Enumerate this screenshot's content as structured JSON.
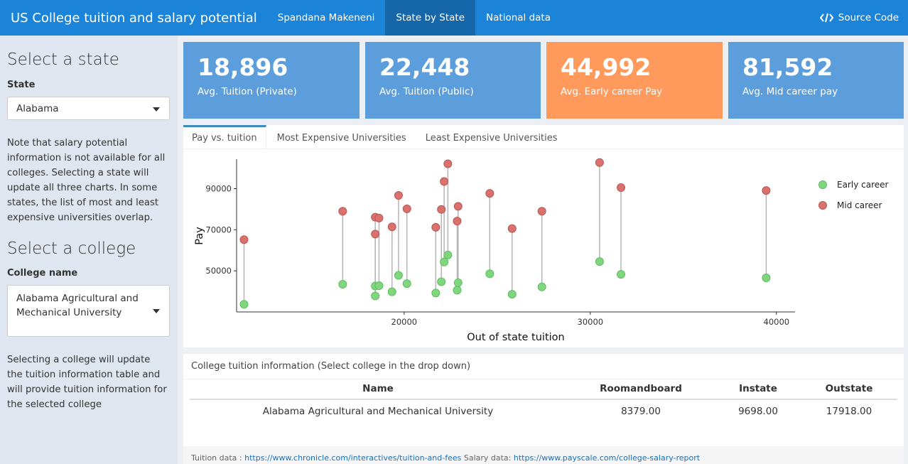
{
  "header": {
    "title": "US College tuition and salary potential",
    "author": "Spandana Makeneni",
    "tabs": [
      "State by State",
      "National data"
    ],
    "source_code": "Source Code"
  },
  "sidebar": {
    "state_heading": "Select a state",
    "state_label": "State",
    "state_value": "Alabama",
    "state_note": "Note that salary potential information is not available for all colleges. Selecting a state will update all three charts. In some states, the list of most and least expensive universities overlap.",
    "college_heading": "Select a college",
    "college_label": "College name",
    "college_value": "Alabama Agricultural and Mechanical University",
    "college_note": "Selecting a college will update the tuition information table and will provide tuition information for the selected college"
  },
  "value_boxes": [
    {
      "value": "18,896",
      "label": "Avg. Tuition (Private)",
      "color": "#5c9ddc"
    },
    {
      "value": "22,448",
      "label": "Avg. Tuition (Public)",
      "color": "#5c9ddc"
    },
    {
      "value": "44,992",
      "label": "Avg. Early career Pay",
      "color": "#ff9a5c"
    },
    {
      "value": "81,592",
      "label": "Avg. Mid career pay",
      "color": "#5c9ddc"
    }
  ],
  "chart_tabs": [
    "Pay vs. tuition",
    "Most Expensive Universities",
    "Least Expensive Universities"
  ],
  "chart_data": {
    "type": "scatter",
    "xlabel": "Out of state tuition",
    "ylabel": "Pay",
    "xlim": [
      11000,
      41000
    ],
    "ylim": [
      30000,
      104000
    ],
    "xticks": [
      20000,
      30000,
      40000
    ],
    "yticks": [
      50000,
      70000,
      90000
    ],
    "xtick_labels": [
      "20000",
      "30000",
      "40000"
    ],
    "ytick_labels": [
      "50000",
      "70000",
      "90000"
    ],
    "legend_position": "top-right",
    "series": [
      {
        "name": "Early career",
        "color": "#7fd67f"
      },
      {
        "name": "Mid career",
        "color": "#d9716e"
      }
    ],
    "points": [
      {
        "x": 11400,
        "early": 33700,
        "mid": 65200
      },
      {
        "x": 16700,
        "early": 43500,
        "mid": 79000
      },
      {
        "x": 18450,
        "early": 42600,
        "mid": 76100
      },
      {
        "x": 18450,
        "early": 37800,
        "mid": 67900
      },
      {
        "x": 18650,
        "early": 42800,
        "mid": 75700
      },
      {
        "x": 19350,
        "early": 39800,
        "mid": 71400
      },
      {
        "x": 19700,
        "early": 47800,
        "mid": 86700
      },
      {
        "x": 20150,
        "early": 43800,
        "mid": 80200
      },
      {
        "x": 21700,
        "early": 39200,
        "mid": 71200
      },
      {
        "x": 22000,
        "early": 44700,
        "mid": 79900
      },
      {
        "x": 22150,
        "early": 54300,
        "mid": 93500
      },
      {
        "x": 22350,
        "early": 57700,
        "mid": 102100
      },
      {
        "x": 22850,
        "early": 40600,
        "mid": 74200
      },
      {
        "x": 22900,
        "early": 44200,
        "mid": 81400
      },
      {
        "x": 24600,
        "early": 48600,
        "mid": 87700
      },
      {
        "x": 25800,
        "early": 38600,
        "mid": 70600
      },
      {
        "x": 27400,
        "early": 42200,
        "mid": 79000
      },
      {
        "x": 30500,
        "early": 54500,
        "mid": 102700
      },
      {
        "x": 31650,
        "early": 48300,
        "mid": 90500
      },
      {
        "x": 39450,
        "early": 46600,
        "mid": 89100
      }
    ]
  },
  "table": {
    "title": "College tuition information (Select college in the drop down)",
    "columns": [
      "Name",
      "Roomandboard",
      "Instate",
      "Outstate"
    ],
    "rows": [
      [
        "Alabama Agricultural and Mechanical University",
        "8379.00",
        "9698.00",
        "17918.00"
      ]
    ]
  },
  "footer": {
    "tuition_prefix": "Tuition data : ",
    "tuition_link": "https://www.chronicle.com/interactives/tuition-and-fees",
    "salary_prefix": " Salary data: ",
    "salary_link": "https://www.payscale.com/college-salary-report"
  }
}
